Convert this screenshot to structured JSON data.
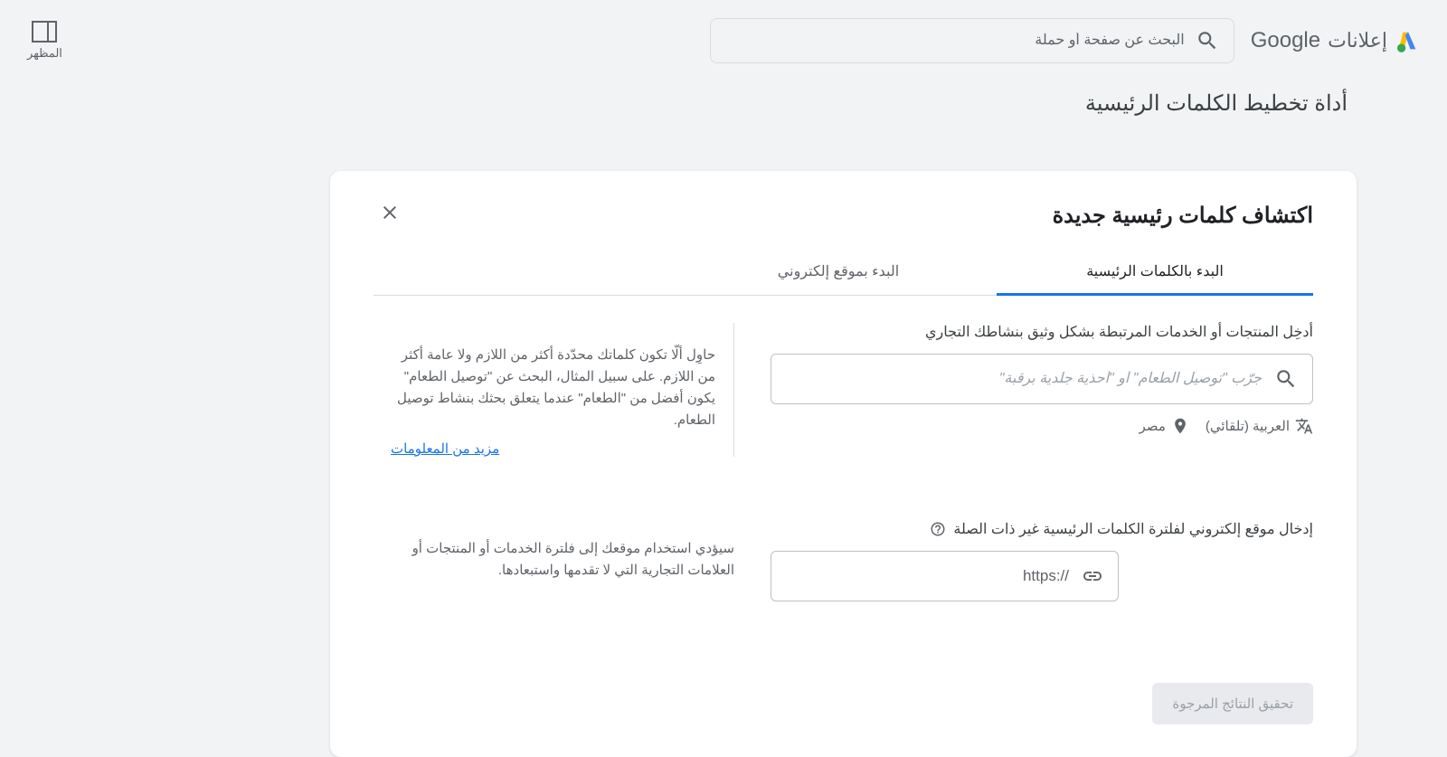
{
  "header": {
    "google_text": "Google",
    "ads_text": "إعلانات",
    "search_placeholder": "البحث عن صفحة أو حملة",
    "appearance_label": "المظهر"
  },
  "page": {
    "title": "أداة تخطيط الكلمات الرئيسية"
  },
  "card": {
    "title": "اكتشاف كلمات رئيسية جديدة",
    "tabs": {
      "keywords": "البدء بالكلمات الرئيسية",
      "website": "البدء بموقع إلكتروني"
    },
    "section1": {
      "label": "أدخِل المنتجات أو الخدمات المرتبطة بشكل وثيق بنشاطك التجاري",
      "placeholder": "جرّب \"توصيل الطعام\" أو \"أحذية جلدية برقبة\"",
      "language": "العربية (تلقائي)",
      "location": "مصر"
    },
    "help1": {
      "text": "حاوِل ألّا تكون كلماتك محدّدة أكثر من اللازم ولا عامة أكثر من اللازم. على سبيل المثال، البحث عن \"توصيل الطعام\" يكون أفضل من \"الطعام\" عندما يتعلق بحثك بنشاط توصيل الطعام.",
      "more": "مزيد من المعلومات"
    },
    "section2": {
      "label": "إدخال موقع إلكتروني لفلترة الكلمات الرئيسية غير ذات الصلة",
      "scheme": "https://"
    },
    "help2": {
      "text": "سيؤدي استخدام موقعك إلى فلترة الخدمات أو المنتجات أو العلامات التجارية التي لا تقدمها واستبعادها."
    },
    "button": "تحقيق النتائج المرجوة"
  }
}
